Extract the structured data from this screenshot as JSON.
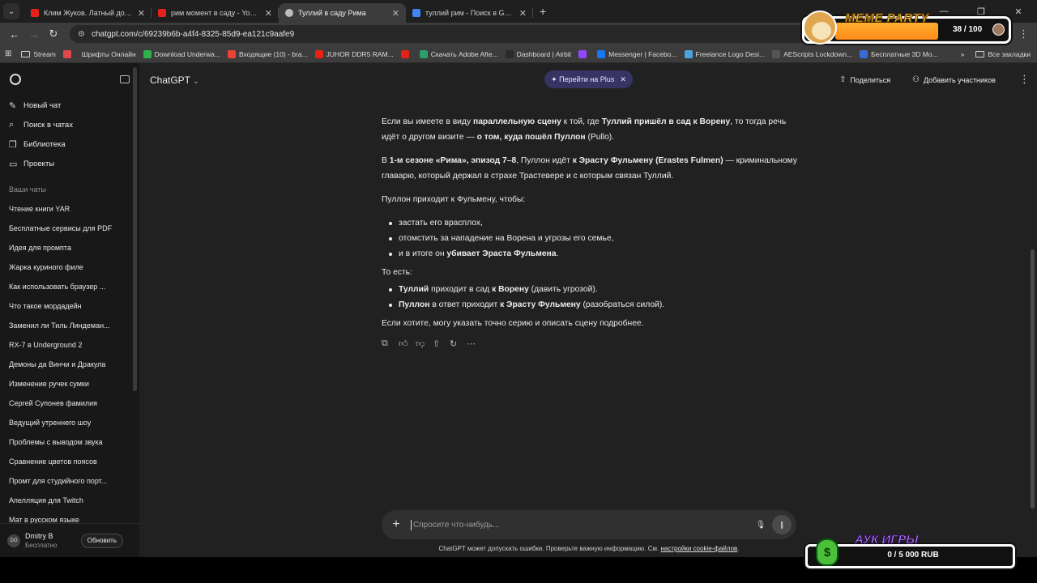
{
  "browser": {
    "tabs": [
      {
        "title": "Клим Жуков. Латный доспех",
        "favicon_color": "#e62117",
        "active": false
      },
      {
        "title": "рим момент в саду - YouTube",
        "favicon_color": "#e62117",
        "active": false
      },
      {
        "title": "Туллий в саду Рима",
        "favicon_color": "#bdbdbd",
        "active": true
      },
      {
        "title": "туллий рим - Поиск в Google",
        "favicon_color": "#4285f4",
        "active": false
      }
    ],
    "url": "chatgpt.com/c/69239b6b-a4f4-8325-85d9-ea121c9aafe9",
    "bookmarks": [
      {
        "label": "Stream",
        "color": "#cfcfcf",
        "folder": true
      },
      {
        "label": "",
        "color": "#e0484f"
      },
      {
        "label": "Шрифты Онлайн",
        "color": ""
      },
      {
        "label": "Download Underwa...",
        "color": "#2bb24c"
      },
      {
        "label": "Входящие (10) - bra...",
        "color": "#ea4335"
      },
      {
        "label": "JUHOR DDR5 RAM...",
        "color": "#e62117"
      },
      {
        "label": "",
        "color": "#e62117"
      },
      {
        "label": "Скачать Adobe Afte...",
        "color": "#29a06a"
      },
      {
        "label": "Dashboard | Airbit",
        "color": "#2a2a2a"
      },
      {
        "label": "",
        "color": "#9146ff"
      },
      {
        "label": "Messenger | Facebo...",
        "color": "#1877f2"
      },
      {
        "label": "Freelance Logo Desi...",
        "color": "#4aa3df"
      },
      {
        "label": "AEScripts Lockdown...",
        "color": "#555555"
      },
      {
        "label": "Бесплатные 3D Mo...",
        "color": "#3a6ad4"
      }
    ],
    "all_bookmarks": "Все закладки"
  },
  "sidebar": {
    "nav": [
      {
        "icon": "edit-icon",
        "label": "Новый чат"
      },
      {
        "icon": "search-icon",
        "label": "Поиск в чатах"
      },
      {
        "icon": "library-icon",
        "label": "Библиотека"
      },
      {
        "icon": "folder-icon",
        "label": "Проекты"
      }
    ],
    "section_title": "Ваши чаты",
    "chats": [
      "Чтение книги YAR",
      "Бесплатные сервисы для PDF",
      "Идея для промпта",
      "Жарка куриного филе",
      "Как использовать браузер ...",
      "Что такое мордадейн",
      "Заменил ли Тиль Линдеман...",
      "RX-7 в Underground 2",
      "Демоны да Винчи и Дракула",
      "Изменение ручек сумки",
      "Сергей Супонев фамилия",
      "Ведущий утреннего шоу",
      "Проблемы с выводом звука",
      "Сравнение цветов поясов",
      "Промт для студийного порт...",
      "Апелляция для Twitch",
      "Мат в русском языке"
    ],
    "user": {
      "initials": "DO",
      "name": "Dmitry B",
      "plan": "Бесплатно",
      "upgrade_label": "Обновить"
    }
  },
  "header": {
    "model": "ChatGPT",
    "plus_label": "✦ Перейти на Plus",
    "share_label": "Поделиться",
    "add_label": "Добавить участников"
  },
  "message": {
    "p1": [
      {
        "t": "Если вы имеете в виду ",
        "b": false
      },
      {
        "t": "параллельную сцену",
        "b": true
      },
      {
        "t": " к той, где ",
        "b": false
      },
      {
        "t": "Туллий пришёл в сад к Ворену",
        "b": true
      },
      {
        "t": ", то тогда речь идёт о другом визите — ",
        "b": false
      },
      {
        "t": "о том, куда пошёл Пуллон",
        "b": true
      },
      {
        "t": " (Pullo).",
        "b": false
      }
    ],
    "p2": [
      {
        "t": "В ",
        "b": false
      },
      {
        "t": "1-м сезоне «Рима», эпизод 7–8",
        "b": true
      },
      {
        "t": ", Пуллон идёт ",
        "b": false
      },
      {
        "t": "к Эрасту Фульмену (Erastes Fulmen)",
        "b": true
      },
      {
        "t": " — криминальному главарю, который держал в страхе Трастевере и с которым связан Туллий.",
        "b": false
      }
    ],
    "p3": "Пуллон приходит к Фульмену, чтобы:",
    "list1": [
      [
        {
          "t": "застать его врасплох,",
          "b": false
        }
      ],
      [
        {
          "t": "отомстить за нападение на Ворена и угрозы его семье,",
          "b": false
        }
      ],
      [
        {
          "t": "и в итоге он ",
          "b": false
        },
        {
          "t": "убивает Эраста Фульмена",
          "b": true
        },
        {
          "t": ".",
          "b": false
        }
      ]
    ],
    "p4": "То есть:",
    "list2": [
      [
        {
          "t": "Туллий",
          "b": true
        },
        {
          "t": " приходит в сад ",
          "b": false
        },
        {
          "t": "к Ворену",
          "b": true
        },
        {
          "t": " (давить угрозой).",
          "b": false
        }
      ],
      [
        {
          "t": "Пуллон",
          "b": true
        },
        {
          "t": " в ответ приходит ",
          "b": false
        },
        {
          "t": "к Эрасту Фульмену",
          "b": true
        },
        {
          "t": " (разобраться силой).",
          "b": false
        }
      ]
    ],
    "p5": "Если хотите, могу указать точно серию и описать сцену подробнее."
  },
  "composer": {
    "placeholder": "Спросите что-нибудь...",
    "disclaimer_text": "ChatGPT может допускать ошибки. Проверьте важную информацию. См. ",
    "disclaimer_link": "настройки cookie-файлов",
    "disclaimer_end": "."
  },
  "overlays": {
    "meme_title": "MEME PARTY",
    "meme_count": "38 / 100",
    "meme_progress": 0.38,
    "auk_title": "АУК ИГРЫ",
    "auk_amount": "0 / 5 000 RUB",
    "auk_icon": "$"
  }
}
